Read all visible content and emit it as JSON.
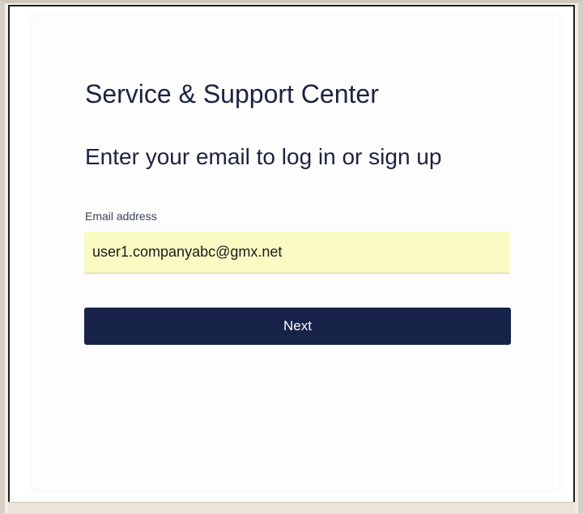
{
  "page": {
    "title": "Service & Support Center",
    "subtitle": "Enter your email to log in or sign up"
  },
  "form": {
    "email_label": "Email address",
    "email_value": "user1.companyabc@gmx.net",
    "next_label": "Next"
  },
  "colors": {
    "primary_button": "#172349",
    "input_autofill": "#fafac3",
    "heading_text": "#1c2340"
  }
}
